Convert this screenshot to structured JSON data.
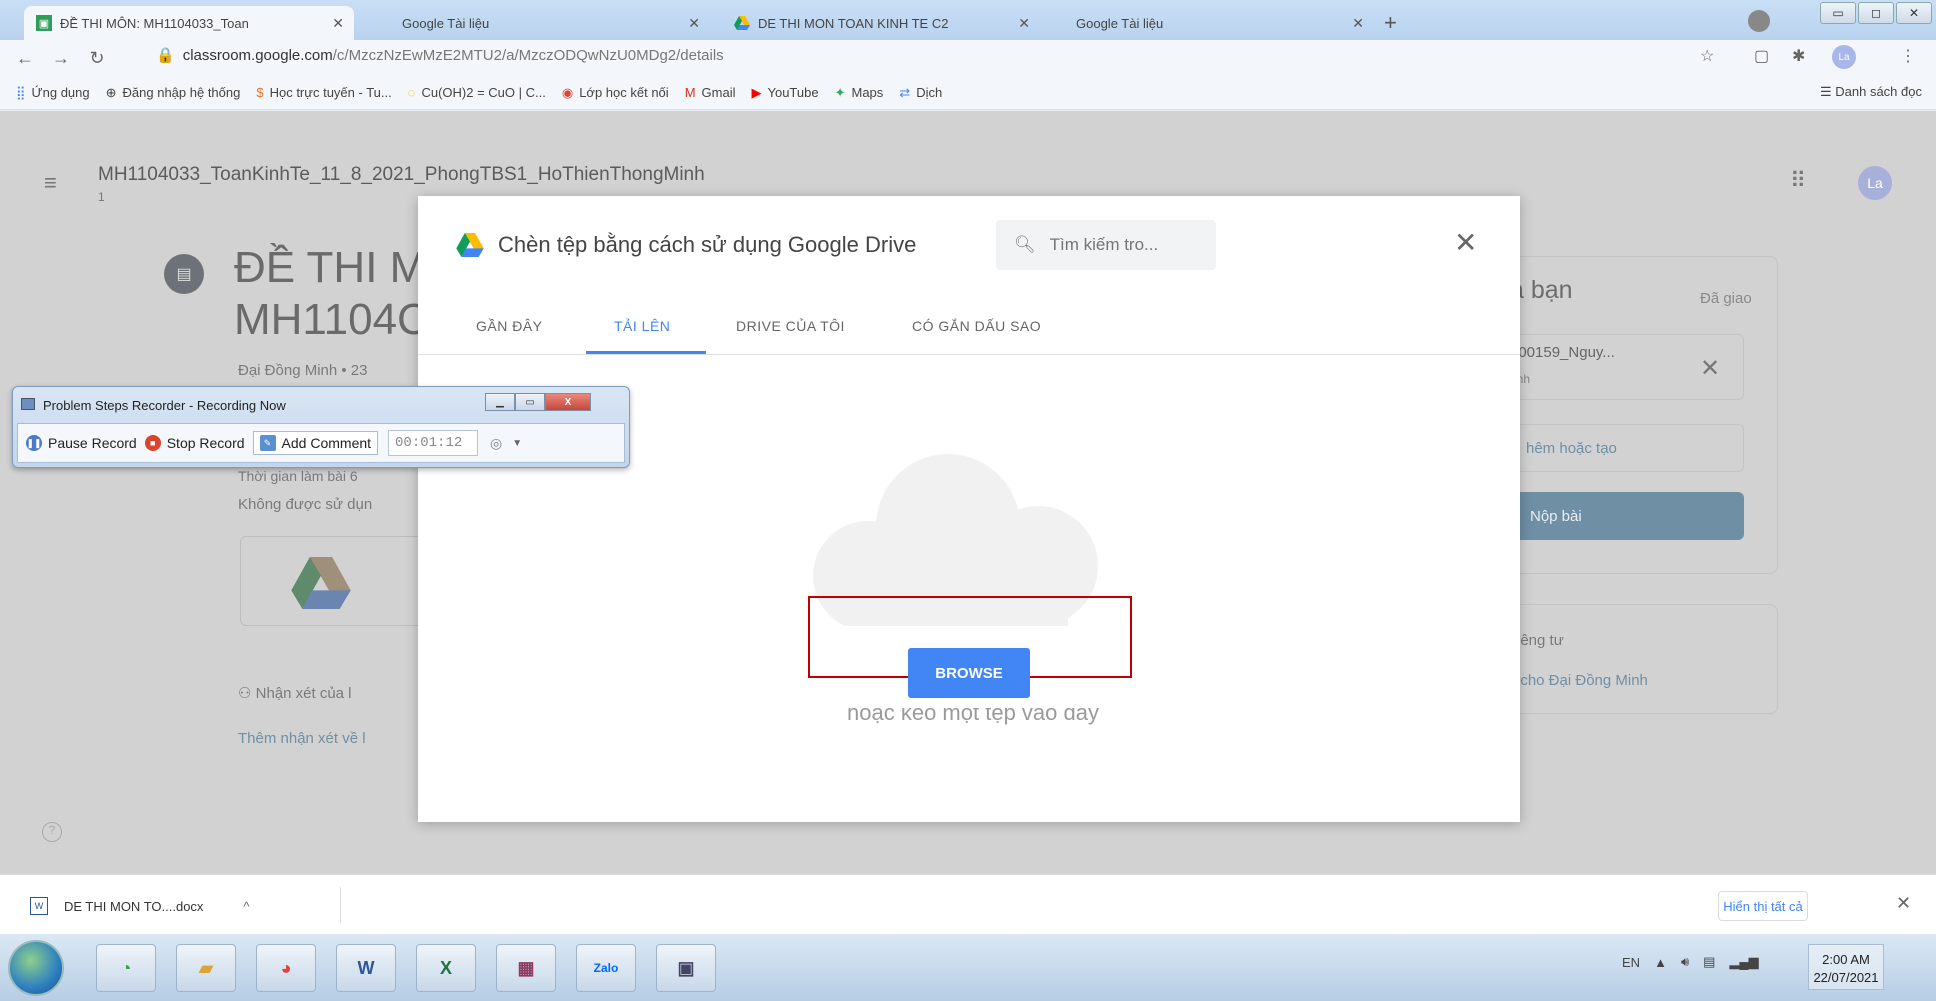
{
  "browser": {
    "tabs": [
      {
        "title": "ĐỀ THI MÔN: MH1104033_Toan",
        "active": true
      },
      {
        "title": "Google Tài liệu",
        "active": false
      },
      {
        "title": "DE THI MON TOAN KINH TE C2",
        "active": false
      },
      {
        "title": "Google Tài liệu",
        "active": false
      }
    ],
    "url_domain": "classroom.google.com",
    "url_path": "/c/MzczNzEwMzE2MTU2/a/MzczODQwNzU0MDg2/details",
    "profile_initials": "La",
    "bookmarks": [
      {
        "label": "Ứng dụng",
        "icon": "apps-grid-icon"
      },
      {
        "label": "Đăng nhập hệ thống",
        "icon": "globe-icon"
      },
      {
        "label": "Học trực tuyến - Tu...",
        "icon": "dollar-icon"
      },
      {
        "label": "Cu(OH)2 = CuO | C...",
        "icon": "loading-icon"
      },
      {
        "label": "Lớp học kết nối",
        "icon": "chrome-icon"
      },
      {
        "label": "Gmail",
        "icon": "gmail-icon"
      },
      {
        "label": "YouTube",
        "icon": "youtube-icon"
      },
      {
        "label": "Maps",
        "icon": "maps-icon"
      },
      {
        "label": "Dịch",
        "icon": "translate-icon"
      }
    ],
    "reading_list": "Danh sách đọc"
  },
  "classroom": {
    "class_title": "MH1104033_ToanKinhTe_11_8_2021_PhongTBS1_HoThienThongMinh",
    "class_subtitle": "1",
    "assignment_title": "ĐỀ THI M MH110⁠4C",
    "assignment_title_l1": "ĐỀ THI M",
    "assignment_title_l2": "MH1104C",
    "author_line": "Đại Đồng Minh • 23",
    "line_partial": "Thời gian làm bài 6",
    "rule_line": "Không được sử dụn",
    "comments_label": "Nhận xét của l",
    "add_comment": "Thêm nhận xét về l",
    "work_title": "a bạn",
    "work_status": "Đã giao",
    "file_name": "100159_Nguy...",
    "file_sub": "ành",
    "add_create": "hêm hoặc tạo",
    "submit": "Nộp bài",
    "private_title": "riêng tư",
    "private_add": "t cho Đại Đồng Minh",
    "user_initials": "La"
  },
  "picker": {
    "title": "Chèn tệp bằng cách sử dụng Google Drive",
    "search_placeholder": "Tìm kiếm tro...",
    "tabs": [
      "GẦN ĐÂY",
      "TẢI LÊN",
      "DRIVE CỦA TÔI",
      "CÓ GẮN DẤU SAO"
    ],
    "active_tab": "TẢI LÊN",
    "browse": "BROWSE",
    "drag_text": "hoặc kéo một tệp vào đây"
  },
  "steps_recorder": {
    "title": "Problem Steps Recorder - Recording Now",
    "pause": "Pause Record",
    "stop": "Stop Record",
    "add_comment": "Add Comment",
    "timer": "00:01:12"
  },
  "download_bar": {
    "file": "DE THI MON TO....docx",
    "show_all": "Hiển thị tất cả"
  },
  "taskbar": {
    "lang": "EN",
    "time": "2:00 AM",
    "date": "22/07/2021",
    "apps": [
      "paint-icon",
      "explorer-icon",
      "chrome-icon",
      "word-icon",
      "excel-icon",
      "winrar-icon",
      "zalo-icon",
      "steps-recorder-icon"
    ],
    "zalo_label": "Zalo",
    "word_label": "W",
    "excel_label": "X"
  },
  "colors": {
    "accent": "#4285f4",
    "highlight_box": "#c00000",
    "submit_bg": "#6f8fa5"
  }
}
